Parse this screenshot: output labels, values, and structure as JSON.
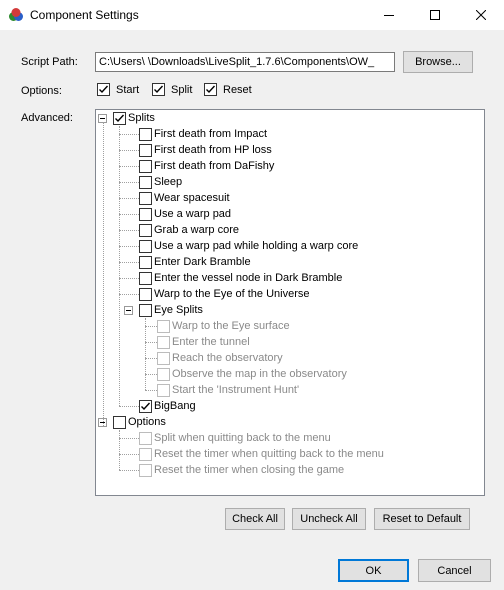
{
  "window": {
    "title": "Component Settings"
  },
  "script_path": {
    "label": "Script Path:",
    "value": "C:\\Users\\        \\Downloads\\LiveSplit_1.7.6\\Components\\OW_",
    "browse_label": "Browse..."
  },
  "options_row": {
    "label": "Options:",
    "items": [
      {
        "label": "Start",
        "checked": true
      },
      {
        "label": "Split",
        "checked": true
      },
      {
        "label": "Reset",
        "checked": true
      }
    ]
  },
  "advanced": {
    "label": "Advanced:",
    "tree": [
      {
        "label": "Splits",
        "checked": true,
        "level": 0,
        "expanded": true,
        "disabled": false
      },
      {
        "label": "First death from Impact",
        "checked": false,
        "level": 1,
        "disabled": false
      },
      {
        "label": "First death from HP loss",
        "checked": false,
        "level": 1,
        "disabled": false
      },
      {
        "label": "First death from DaFishy",
        "checked": false,
        "level": 1,
        "disabled": false
      },
      {
        "label": "Sleep",
        "checked": false,
        "level": 1,
        "disabled": false
      },
      {
        "label": "Wear spacesuit",
        "checked": false,
        "level": 1,
        "disabled": false
      },
      {
        "label": "Use a warp pad",
        "checked": false,
        "level": 1,
        "disabled": false
      },
      {
        "label": "Grab a warp core",
        "checked": false,
        "level": 1,
        "disabled": false
      },
      {
        "label": "Use a warp pad while holding a warp core",
        "checked": false,
        "level": 1,
        "disabled": false
      },
      {
        "label": "Enter Dark Bramble",
        "checked": false,
        "level": 1,
        "disabled": false
      },
      {
        "label": "Enter the vessel node in Dark Bramble",
        "checked": false,
        "level": 1,
        "disabled": false
      },
      {
        "label": "Warp to the Eye of the Universe",
        "checked": false,
        "level": 1,
        "disabled": false
      },
      {
        "label": "Eye Splits",
        "checked": false,
        "level": 1,
        "expanded": true,
        "disabled": false
      },
      {
        "label": "Warp to the Eye surface",
        "checked": false,
        "level": 2,
        "disabled": true
      },
      {
        "label": "Enter the tunnel",
        "checked": false,
        "level": 2,
        "disabled": true
      },
      {
        "label": "Reach the observatory",
        "checked": false,
        "level": 2,
        "disabled": true
      },
      {
        "label": "Observe the map in the observatory",
        "checked": false,
        "level": 2,
        "disabled": true
      },
      {
        "label": "Start the 'Instrument Hunt'",
        "checked": false,
        "level": 2,
        "disabled": true
      },
      {
        "label": "BigBang",
        "checked": true,
        "level": 1,
        "disabled": false
      },
      {
        "label": "Options",
        "checked": false,
        "level": 0,
        "expanded": true,
        "disabled": false
      },
      {
        "label": "Split when quitting back to the menu",
        "checked": false,
        "level": 1,
        "disabled": true
      },
      {
        "label": "Reset the timer when quitting back to the menu",
        "checked": false,
        "level": 1,
        "disabled": true
      },
      {
        "label": "Reset the timer when closing the game",
        "checked": false,
        "level": 1,
        "disabled": true
      }
    ]
  },
  "buttons": {
    "check_all": "Check All",
    "uncheck_all": "Uncheck All",
    "reset_default": "Reset to Default",
    "ok": "OK",
    "cancel": "Cancel"
  },
  "colors": {
    "ok_border": "#0078d7",
    "button_face": "#e1e1e1",
    "dialog_bg": "#f0f0f0",
    "disabled_text": "#8a8a8a"
  }
}
